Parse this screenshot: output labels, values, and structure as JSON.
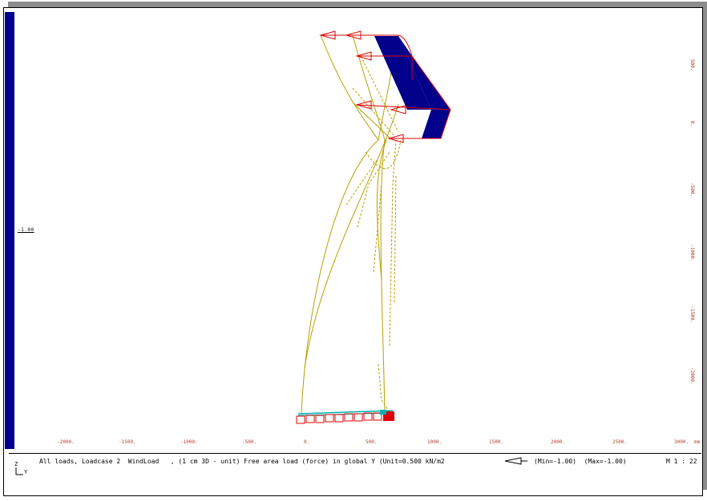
{
  "legend": {
    "value": "-1.00",
    "bar_color": "#00008b"
  },
  "x_axis": {
    "ticks": [
      "-2000.",
      "-1500.",
      "-1000.",
      "-500.",
      "0.",
      "500.",
      "1000.",
      "1500.",
      "2000.",
      "2500.",
      "3000."
    ],
    "unit": "mm"
  },
  "y_axis": {
    "ticks": [
      "500.",
      "0.",
      "-500.",
      "-1000.",
      "-1500.",
      "-2000."
    ]
  },
  "status": {
    "description": "All loads, Loadcase 2  WindLoad   , (1 cm 3D - unit) Free area load (force) in global Y (Unit=0.500 kN/m2",
    "minmax": "(Min=-1.00)  (Max=-1.00)",
    "scale": "M 1 : 22",
    "axis_z": "Z",
    "axis_y": "Y"
  },
  "colors": {
    "structure": "#b8a000",
    "load_fill": "#00008b",
    "arrows": "#e00000",
    "support": "#00b0b0"
  }
}
